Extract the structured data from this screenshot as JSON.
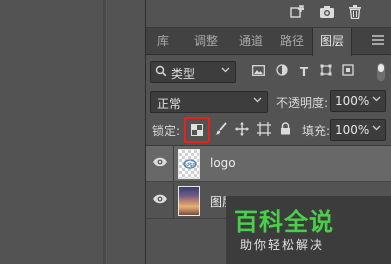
{
  "top_toolbar": {
    "icons": [
      "new-layer-icon",
      "camera-icon",
      "trash-icon"
    ]
  },
  "tabs": [
    {
      "label": "库",
      "active": false
    },
    {
      "label": "调整",
      "active": false
    },
    {
      "label": "通道",
      "active": false
    },
    {
      "label": "路径",
      "active": false
    },
    {
      "label": "图层",
      "active": true
    }
  ],
  "filter": {
    "label": "类型",
    "icons": [
      "image-filter-icon",
      "adjustment-filter-icon",
      "type-filter-icon",
      "shape-filter-icon",
      "smart-object-filter-icon"
    ]
  },
  "blend": {
    "mode": "正常",
    "opacity_label": "不透明度:",
    "opacity_value": "100%"
  },
  "lock": {
    "label": "锁定:",
    "fill_label": "填充:",
    "fill_value": "100%",
    "highlight_color": "#e8211f"
  },
  "layers": [
    {
      "name": "logo",
      "visible": true,
      "selected": true
    },
    {
      "name": "图层 0",
      "visible": true,
      "selected": false
    }
  ],
  "watermark": {
    "main": "百科全说",
    "sub": "助你轻松解决",
    "color": "#49d049"
  }
}
